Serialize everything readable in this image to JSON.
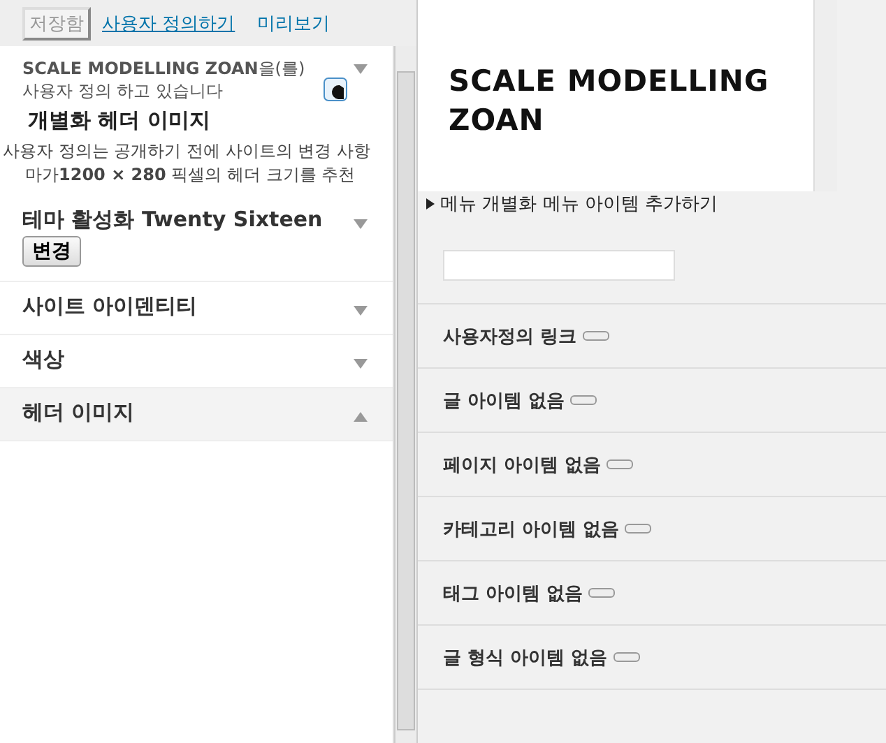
{
  "toolbar": {
    "save_button": "저장함",
    "links": [
      {
        "label": "사용자 정의하기",
        "underlined": true
      },
      {
        "label": "미리보기",
        "underlined": false
      }
    ]
  },
  "info": {
    "title": "**SCALE MODELLING ZOAN**을(를) 사용자 정의 하고 있습니다",
    "heading": "개별화 헤더 이미지",
    "description": "사용자 정의는 공개하기 전에 사이트의 변경 사항",
    "note": "마가**1200 × 280** 픽셀의 헤더 크기를 추천"
  },
  "sections": [
    {
      "title": "테마 활성화 Twenty Sixteen",
      "expanded": false,
      "button": "변경"
    },
    {
      "title": "사이트 아이덴티티",
      "expanded": false
    },
    {
      "title": "색상",
      "expanded": false
    },
    {
      "title": "헤더 이미지",
      "expanded": true
    }
  ],
  "preview": {
    "site_title": "SCALE MODELLING ZOAN"
  },
  "menu_panel": {
    "title": "메뉴 개별화 메뉴 아이템 추가하기",
    "items": [
      "사용자정의 링크",
      "글 아이템 없음",
      "페이지 아이템 없음",
      "카테고리 아이템 없음",
      "태그 아이템 없음",
      "글 형식 아이템 없음"
    ]
  }
}
